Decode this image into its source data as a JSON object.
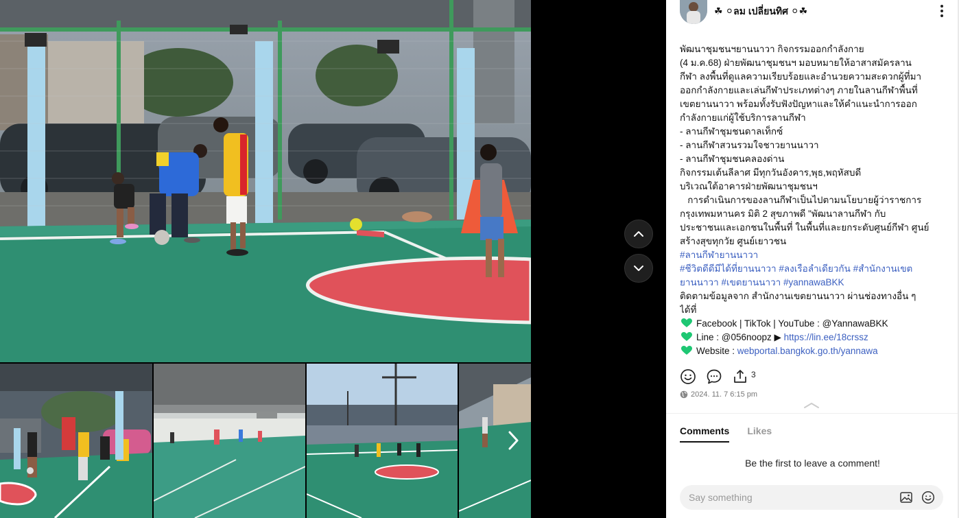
{
  "post": {
    "author": "☘ ⚪ลม เปลี่ยนทิศ ⚪☘",
    "body_lines": [
      "พัฒนาชุมชนฯยานนาวา กิจกรรมออกกำลังกาย",
      " (4 ม.ค.68)  ฝ่ายพัฒนาชุมชนฯ มอบหมายให้อาสาสมัครลาน",
      "กีฬา ลงพื้นที่ดูแลความเรียบร้อยและอำนวยความสะดวกผู้ที่มา",
      "ออกกำลังกายและเล่นกีฬาประเภทต่างๆ ภายในลานกีฬาพื้นที่",
      "เขตยานนาวา พร้อมทั้งรับฟังปัญหาและให้คำแนะนำการออก",
      "กำลังกายแก่ผู้ใช้บริการลานกีฬา",
      "- ลานกีฬาชุมชนดาลเท็กซ์",
      "- ลานกีฬาสวนรวมใจชาวยานนาวา",
      "- ลานกีฬาชุมชนคลองด่าน",
      "กิจกรรมเต้นลีลาศ มีทุกวันอังคาร,พุธ,พฤหัสบดี",
      "บริเวณใต้อาคารฝ่ายพัฒนาชุมชนฯ",
      "   การดำเนินการของลานกีฬาเป็นไปตามนโยบายผู้ว่าราชการ",
      "กรุงเทพมหานคร  มิติ 2 สุขภาพดี  \"พัฒนาลานกีฬา กับ",
      "ประชาชนและเอกชนในพื้นที่ ในพื้นที่และยกระดับศูนย์กีฬา ศูนย์",
      "สร้างสุขทุกวัย ศูนย์เยาวชน"
    ],
    "hashtag_line1": "#ลานกีฬายานนาวา",
    "hashtag_line2": "#ชีวิตดีดีมีได้ที่ยานนาวา #ลงเรือลำเดียวกัน #สำนักงานเขต",
    "hashtag_line3": "ยานนาวา #เขตยานนาวา #yannawaBKK",
    "follow_line1": "ติดตามข้อมูลจาก สำนักงานเขตยานนาวา ผ่านช่องทางอื่น ๆ",
    "follow_line2": "ได้ที่",
    "social_label": "Facebook | TikTok | YouTube : @YannawaBKK",
    "line_label": "Line : @056noopz ▶ ",
    "line_url": "https://lin.ee/18crssz",
    "website_label": "Website : ",
    "website_url": "webportal.bangkok.go.th/yannawa",
    "share_count": "3",
    "timestamp": "2024. 11. 7 6:15 pm"
  },
  "tabs": {
    "comments": "Comments",
    "likes": "Likes"
  },
  "comments": {
    "empty_message": "Be the first to leave a comment!"
  },
  "composer": {
    "placeholder": "Say something"
  },
  "colors": {
    "accent_link": "#3b5fc0",
    "heart": "#1ec773",
    "court_green": "#2f8f72",
    "court_red": "#e0525a"
  },
  "icons": [
    "avatar",
    "more-vertical-icon",
    "smile-icon",
    "comment-icon",
    "share-icon",
    "globe-icon",
    "chevron-up-icon",
    "chevron-down-icon",
    "chevron-right-icon",
    "heart-icon",
    "image-icon",
    "emoji-icon"
  ]
}
